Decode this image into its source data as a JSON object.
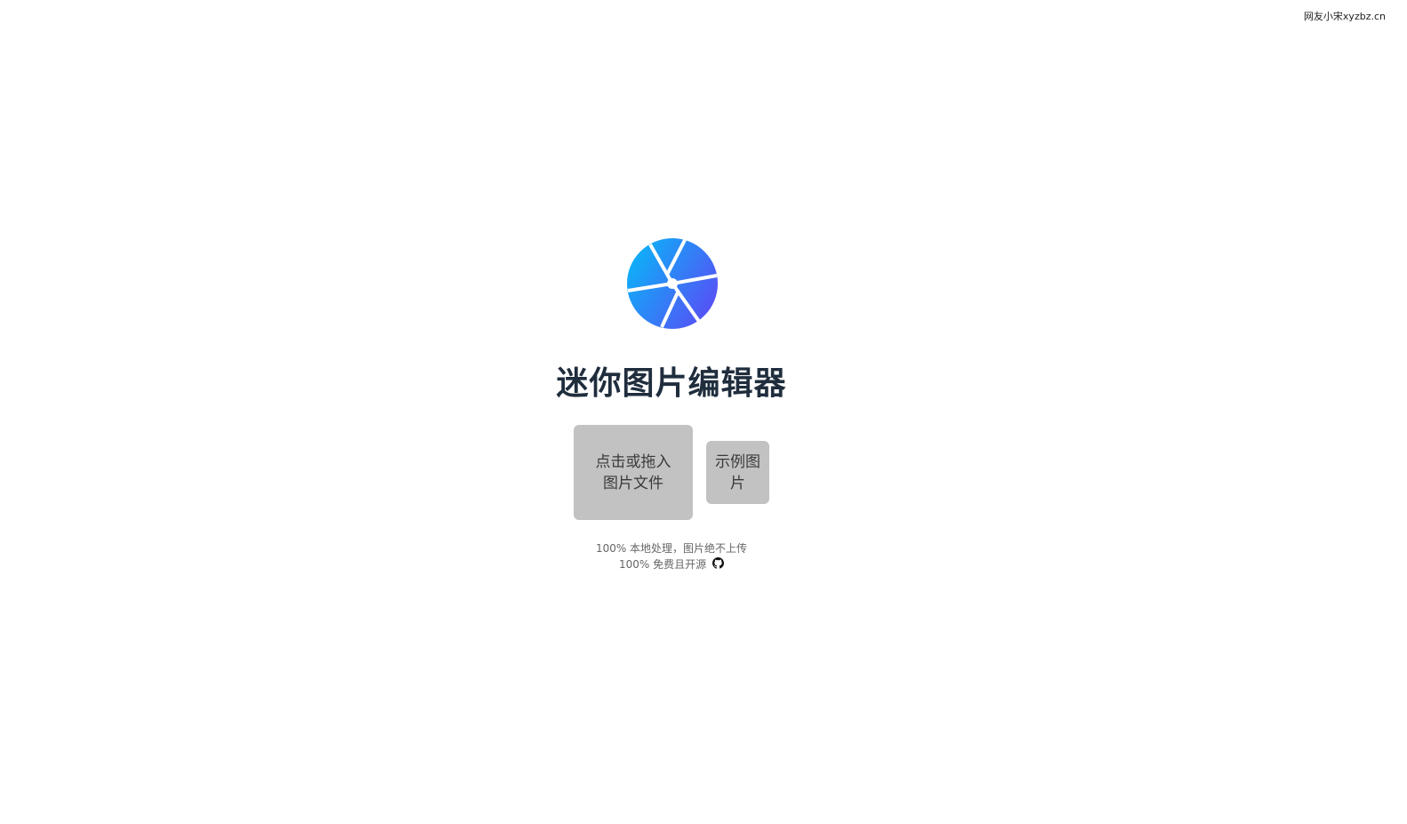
{
  "credit": "网友小宋xyzbz.cn",
  "app": {
    "title": "迷你图片编辑器",
    "logo_icon": "camera-aperture-icon",
    "logo_gradient": [
      "#0ab4f8",
      "#5a4cf5"
    ]
  },
  "buttons": {
    "upload_label": "点击或拖入图片文件",
    "sample_label": "示例图片"
  },
  "notes": {
    "line1": "100% 本地处理，图片绝不上传",
    "line2": "100% 免费且开源",
    "github_icon": "github-icon"
  },
  "colors": {
    "title": "#1f2d3d",
    "button_bg": "#c2c2c2",
    "note_text": "#666666"
  }
}
